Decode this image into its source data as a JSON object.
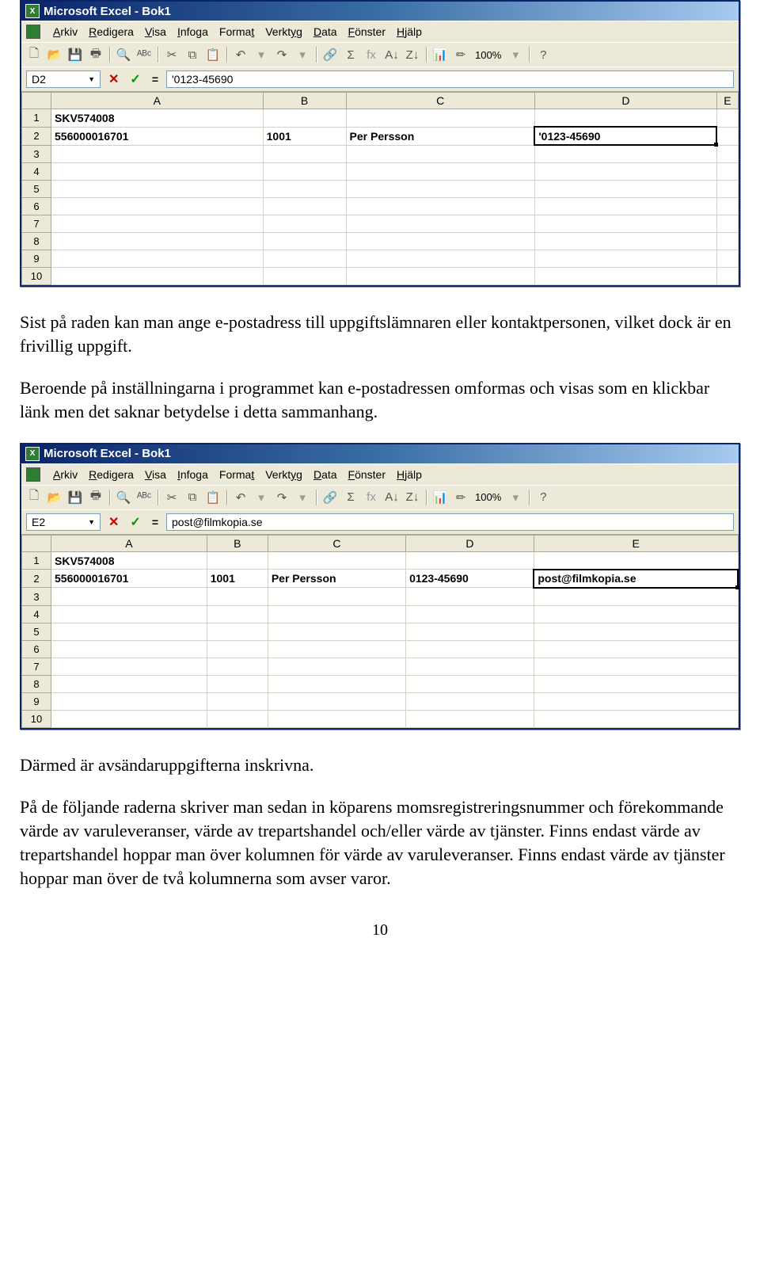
{
  "excel1": {
    "title": "Microsoft Excel - Bok1",
    "menu": [
      "Arkiv",
      "Redigera",
      "Visa",
      "Infoga",
      "Format",
      "Verktyg",
      "Data",
      "Fönster",
      "Hjälp"
    ],
    "namebox": "D2",
    "formula": "'0123-45690",
    "zoom": "100%",
    "cols": [
      "A",
      "B",
      "C",
      "D",
      "E"
    ],
    "rows": [
      "1",
      "2",
      "3",
      "4",
      "5",
      "6",
      "7",
      "8",
      "9",
      "10"
    ],
    "cell_A1": "SKV574008",
    "cell_A2": "556000016701",
    "cell_B2": "1001",
    "cell_C2": "Per Persson",
    "cell_D2": "'0123-45690",
    "selected": "D2"
  },
  "para1": "Sist på raden kan man ange e-postadress till uppgiftslämnaren eller kontaktpersonen, vilket dock är en frivillig uppgift.",
  "para2": "Beroende på inställningarna i programmet kan e-postadressen omformas och visas som en klickbar länk men det saknar betydelse i detta sammanhang.",
  "excel2": {
    "title": "Microsoft Excel - Bok1",
    "menu": [
      "Arkiv",
      "Redigera",
      "Visa",
      "Infoga",
      "Format",
      "Verktyg",
      "Data",
      "Fönster",
      "Hjälp"
    ],
    "namebox": "E2",
    "formula": "post@filmkopia.se",
    "zoom": "100%",
    "cols": [
      "A",
      "B",
      "C",
      "D",
      "E"
    ],
    "rows": [
      "1",
      "2",
      "3",
      "4",
      "5",
      "6",
      "7",
      "8",
      "9",
      "10"
    ],
    "cell_A1": "SKV574008",
    "cell_A2": "556000016701",
    "cell_B2": "1001",
    "cell_C2": "Per Persson",
    "cell_D2": "0123-45690",
    "cell_E2": "post@filmkopia.se",
    "selected": "E2"
  },
  "para3": "Därmed är avsändaruppgifterna inskrivna.",
  "para4": "På de följande raderna skriver man sedan in köparens momsregistreringsnummer och förekommande värde av varuleveranser, värde av trepartshandel och/eller värde av tjänster. Finns endast värde av trepartshandel hoppar man över kolumnen för värde av varuleveranser. Finns endast värde av tjänster hoppar man över de två kolumnerna som avser varor.",
  "pagenum": "10",
  "icons": {
    "new": "🗋",
    "open": "📂",
    "save": "💾",
    "print": "🖶",
    "preview": "🔍",
    "spell": "✓",
    "cut": "✂",
    "copy": "⧉",
    "paste": "📋",
    "undo": "↶",
    "redo": "↷",
    "link": "🔗",
    "sum": "Σ",
    "fx": "fx",
    "sortasc": "A↓",
    "sortdesc": "Z↓",
    "chart": "📊",
    "draw": "✏",
    "help": "?"
  }
}
